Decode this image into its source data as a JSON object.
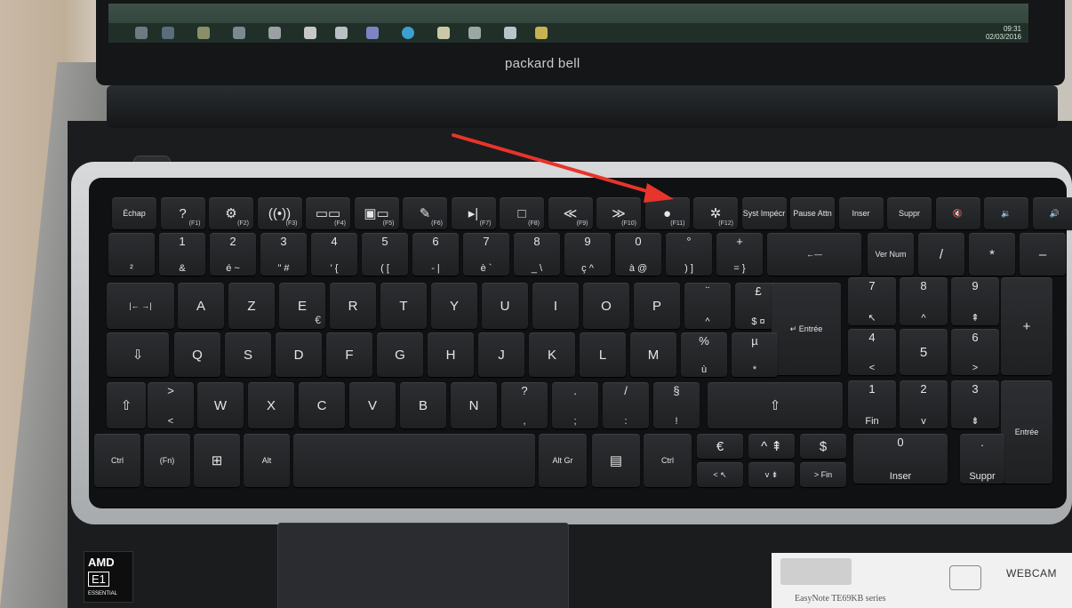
{
  "laptop": {
    "brand": "packard bell",
    "model": "EasyNote TE69KB series",
    "webcam_label": "WEBCAM",
    "cpu_brand": "AMD",
    "cpu_model": "E1",
    "cpu_tier": "ESSENTIAL",
    "clock": {
      "time": "09:31",
      "date": "02/03/2016"
    }
  },
  "annotation": {
    "color": "#e8342a",
    "target_key": "Syst Impécr"
  },
  "keyboard": {
    "fn_row": [
      {
        "main": "Échap",
        "sub": ""
      },
      {
        "main": "?",
        "sub": "(F1)"
      },
      {
        "main": "⚙",
        "sub": "(F2)"
      },
      {
        "main": "((•))",
        "sub": "(F3)"
      },
      {
        "main": "▭▭",
        "sub": "(F4)"
      },
      {
        "main": "▣▭",
        "sub": "(F5)"
      },
      {
        "main": "✎",
        "sub": "(F6)"
      },
      {
        "main": "▸|",
        "sub": "(F7)"
      },
      {
        "main": "□",
        "sub": "(F8)"
      },
      {
        "main": "≪",
        "sub": "(F9)"
      },
      {
        "main": "≫",
        "sub": "(F10)"
      },
      {
        "main": "●",
        "sub": "(F11)"
      },
      {
        "main": "✲",
        "sub": "(F12)"
      },
      {
        "main": "Syst Impécr",
        "sub": ""
      },
      {
        "main": "Pause Attn",
        "sub": ""
      },
      {
        "main": "Inser",
        "sub": ""
      },
      {
        "main": "Suppr",
        "sub": ""
      },
      {
        "main": "🔇",
        "sub": ""
      },
      {
        "main": "🔉",
        "sub": ""
      },
      {
        "main": "🔊",
        "sub": ""
      },
      {
        "main": "⌂",
        "sub": ""
      }
    ],
    "num_row": [
      {
        "top": "",
        "bot": "²"
      },
      {
        "top": "1",
        "bot": "&"
      },
      {
        "top": "2",
        "bot": "é ~"
      },
      {
        "top": "3",
        "bot": "\" #"
      },
      {
        "top": "4",
        "bot": "' {"
      },
      {
        "top": "5",
        "bot": "( ["
      },
      {
        "top": "6",
        "bot": "- |"
      },
      {
        "top": "7",
        "bot": "è `"
      },
      {
        "top": "8",
        "bot": "_ \\"
      },
      {
        "top": "9",
        "bot": "ç ^"
      },
      {
        "top": "0",
        "bot": "à @"
      },
      {
        "top": "°",
        "bot": ") ]"
      },
      {
        "top": "+",
        "bot": "= }"
      },
      {
        "top": "←—",
        "bot": ""
      },
      {
        "top": "Ver Num",
        "bot": ""
      },
      {
        "top": "/",
        "bot": ""
      },
      {
        "top": "*",
        "bot": ""
      },
      {
        "top": "–",
        "bot": ""
      }
    ],
    "azerty_row": [
      "A",
      "Z",
      "E",
      "R",
      "T",
      "Y",
      "U",
      "I",
      "O",
      "P"
    ],
    "azerty_extra": [
      {
        "top": "¨",
        "bot": "^"
      },
      {
        "top": "£",
        "bot": "$ ¤"
      }
    ],
    "enter_label": "↵ Entrée",
    "tab_label": "|← →|",
    "euro": "€",
    "qsdf_row": [
      "Q",
      "S",
      "D",
      "F",
      "G",
      "H",
      "J",
      "K",
      "L",
      "M"
    ],
    "qsdf_extra": [
      {
        "top": "%",
        "bot": "ù"
      },
      {
        "top": "µ",
        "bot": "*"
      }
    ],
    "caps_label": "⇩",
    "wxcv_row": [
      "W",
      "X",
      "C",
      "V",
      "B",
      "N"
    ],
    "wxcv_extra": [
      {
        "top": "?",
        "bot": ","
      },
      {
        "top": ".",
        "bot": ";"
      },
      {
        "top": "/",
        "bot": ":"
      },
      {
        "top": "§",
        "bot": "!"
      }
    ],
    "shift_label": "⇧",
    "lt_gt": {
      "top": ">",
      "bot": "<"
    },
    "bottom_row": {
      "ctrl": "Ctrl",
      "fn": "(Fn)",
      "win": "⊞",
      "alt": "Alt",
      "altgr": "Alt Gr",
      "menu": "▤",
      "ctrl2": "Ctrl"
    },
    "arrows": {
      "up": "^ ⇞",
      "left": "< ↖",
      "down": "v ⇟",
      "right": "> Fin",
      "euro": "€",
      "dollar": "$"
    },
    "numpad": [
      {
        "top": "7",
        "bot": "↖"
      },
      {
        "top": "8",
        "bot": "^"
      },
      {
        "top": "9",
        "bot": "⇞"
      },
      {
        "top": "+",
        "bot": ""
      },
      {
        "top": "4",
        "bot": "<"
      },
      {
        "top": "5",
        "bot": ""
      },
      {
        "top": "6",
        "bot": ">"
      },
      {
        "top": "1",
        "bot": "Fin"
      },
      {
        "top": "2",
        "bot": "v"
      },
      {
        "top": "3",
        "bot": "⇟"
      },
      {
        "top": "Entrée",
        "bot": ""
      },
      {
        "top": "0",
        "bot": "Inser"
      },
      {
        "top": ".",
        "bot": "Suppr"
      }
    ]
  }
}
